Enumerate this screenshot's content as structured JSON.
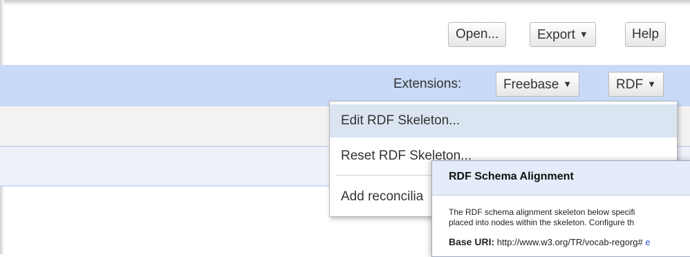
{
  "toolbar": {
    "open_label": "Open...",
    "export_label": "Export",
    "help_label": "Help"
  },
  "extensions": {
    "label": "Extensions:",
    "freebase_label": "Freebase",
    "rdf_label": "RDF"
  },
  "rdf_menu": {
    "items": [
      {
        "label": "Edit RDF Skeleton..."
      },
      {
        "label": "Reset RDF Skeleton..."
      },
      {
        "label": "Add reconcilia"
      }
    ]
  },
  "dialog": {
    "title": "RDF Schema Alignment",
    "description_line1": "The RDF schema alignment skeleton below specifi",
    "description_line2": "placed into nodes within the skeleton. Configure th",
    "base_uri_label": "Base URI:",
    "base_uri_value": "http://www.w3.org/TR/vocab-regorg#",
    "edit_link": "e"
  },
  "colors": {
    "extension_bar": "#c8daf7",
    "menu_highlight": "#dbe5f2",
    "dialog_header": "#e3ecf8",
    "link": "#2a4fd0"
  },
  "icons": {
    "dropdown": "caret-down-icon"
  }
}
